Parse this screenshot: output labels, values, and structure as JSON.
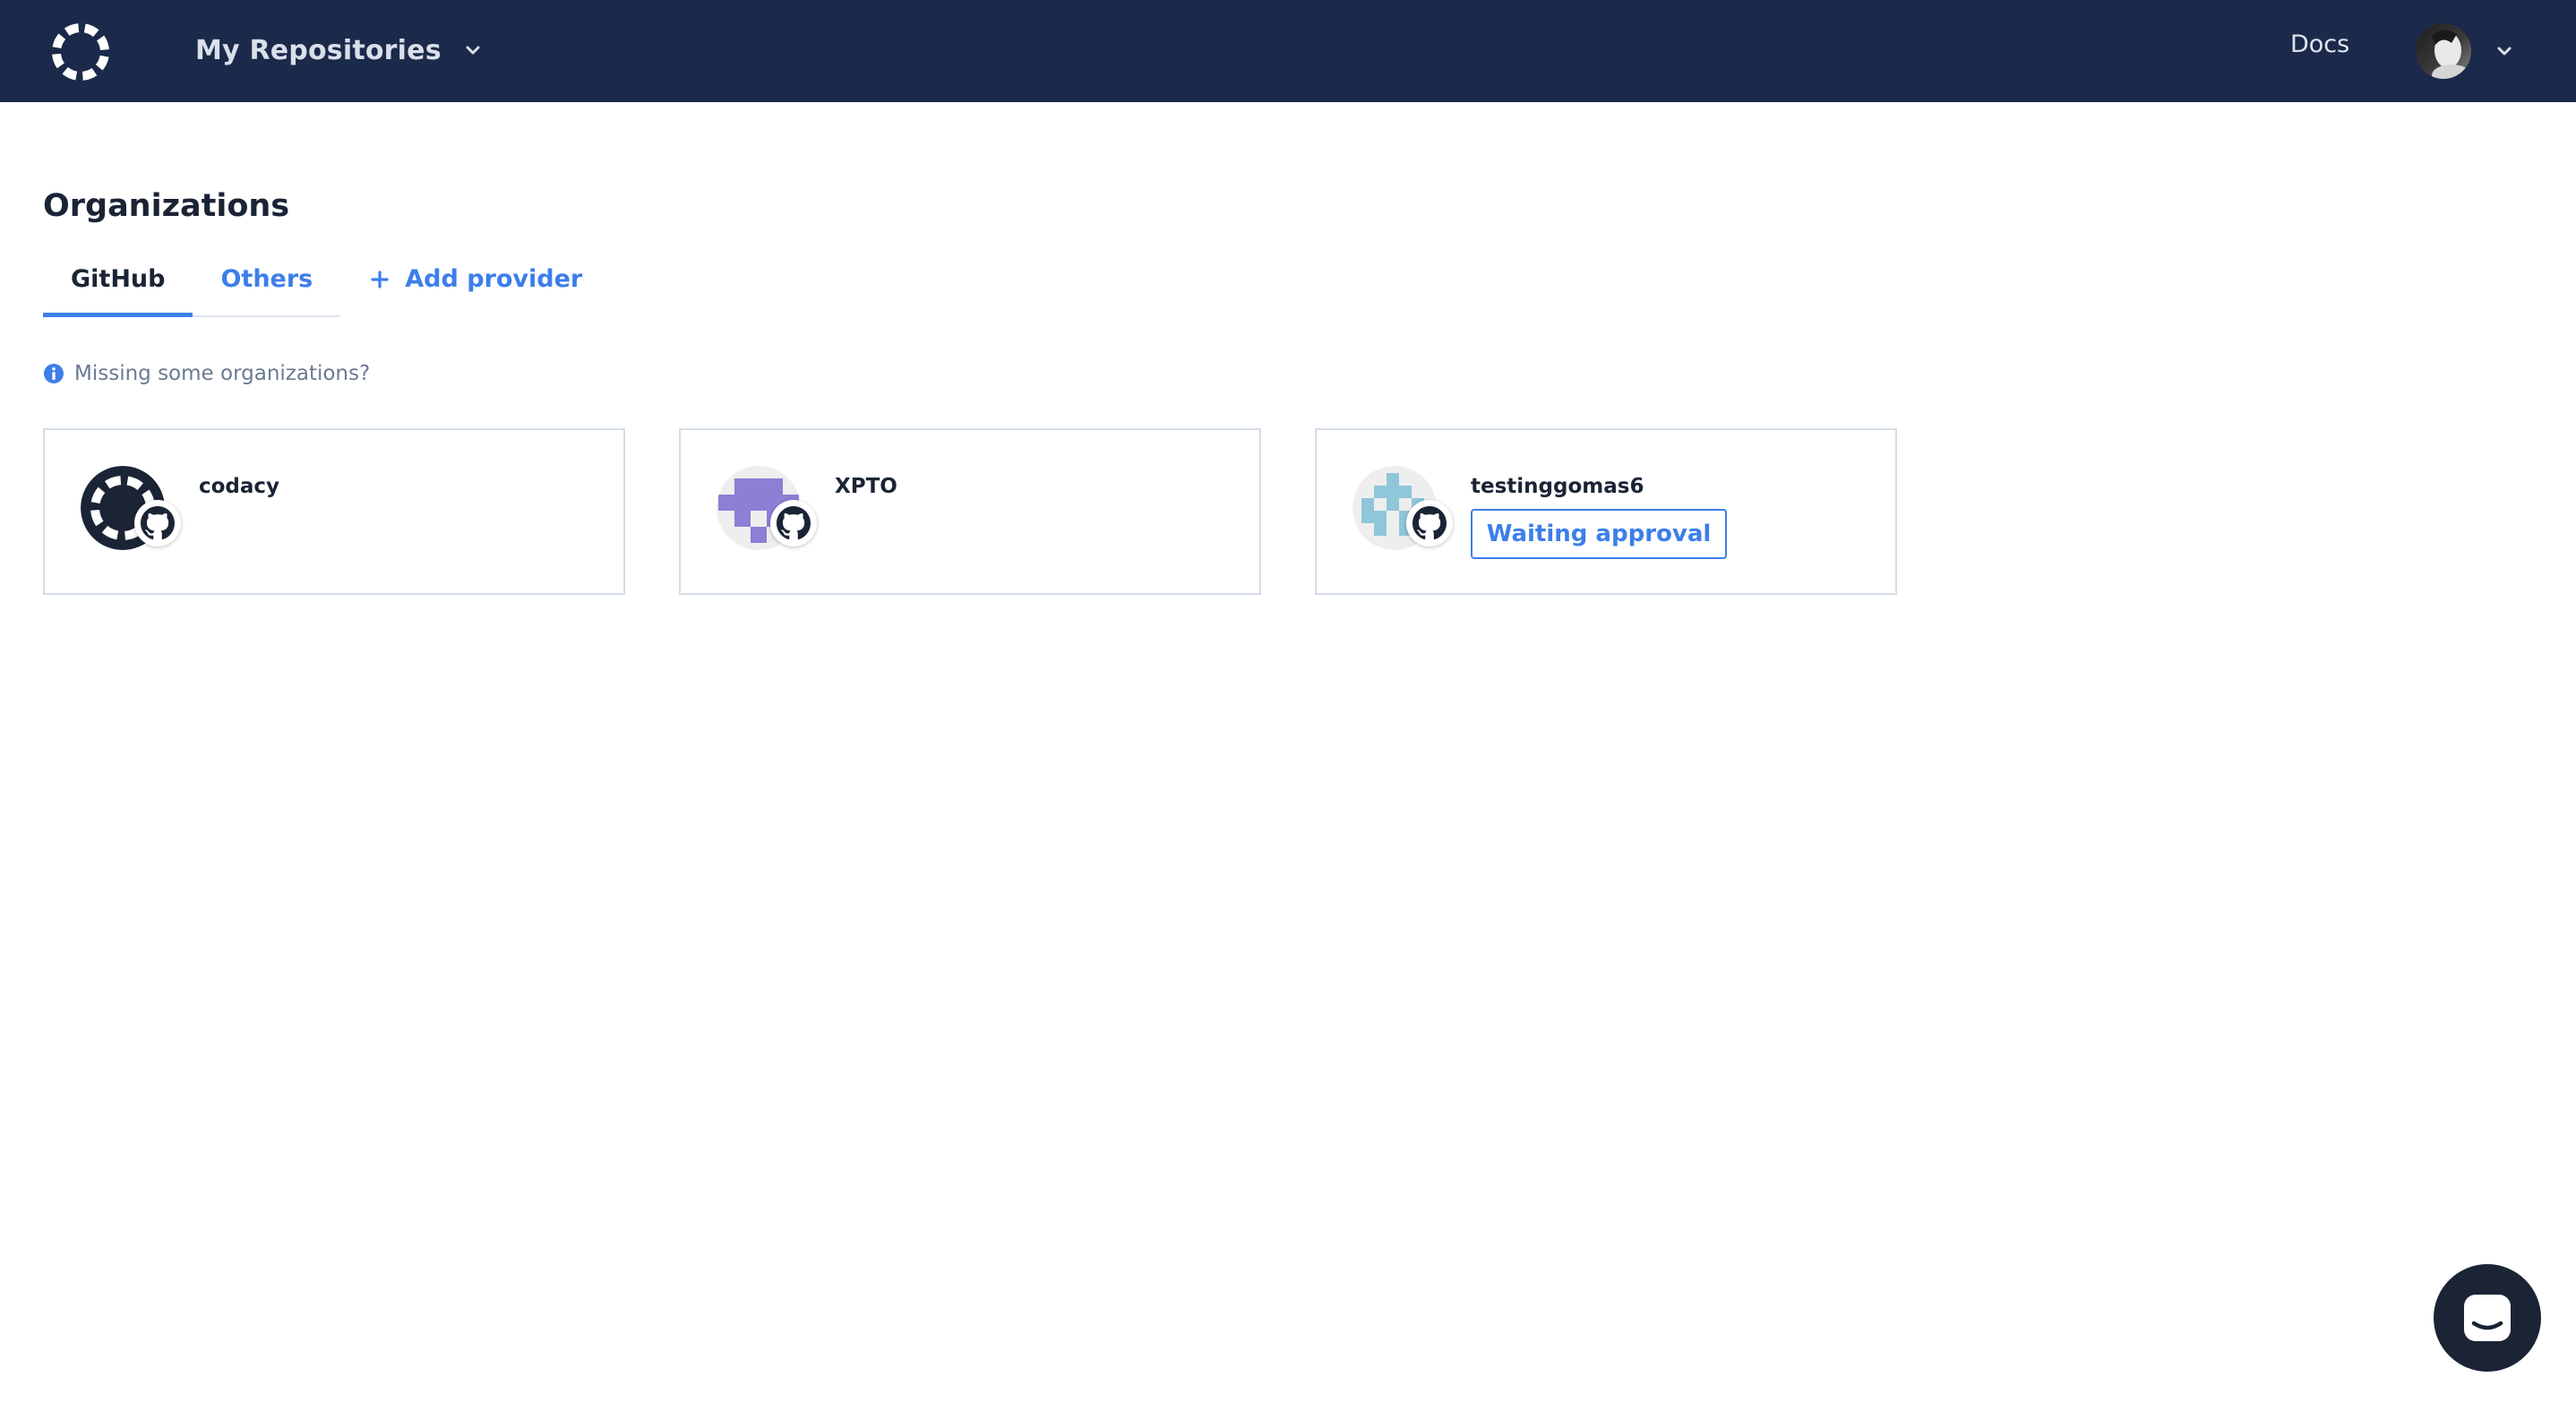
{
  "header": {
    "repo_switch_label": "My Repositories",
    "docs_label": "Docs"
  },
  "page": {
    "title": "Organizations"
  },
  "tabs": [
    {
      "label": "GitHub",
      "active": true
    },
    {
      "label": "Others",
      "active": false
    }
  ],
  "add_provider_label": "Add provider",
  "hint_text": "Missing some organizations?",
  "organizations": [
    {
      "name": "codacy",
      "status": ""
    },
    {
      "name": "XPTO",
      "status": ""
    },
    {
      "name": "testinggomas6",
      "status": "Waiting approval"
    }
  ],
  "colors": {
    "header_bg": "#1b2a4a",
    "accent": "#3d7eea",
    "card_border": "#d3dce8",
    "text_primary": "#1a2435",
    "text_muted": "#6b7a93",
    "xpto_avatar": "#8b7fd6",
    "testing_avatar": "#8fc6d9"
  },
  "icons": {
    "logo": "codacy-logo-icon",
    "chevron": "chevron-down-icon",
    "plus": "plus-icon",
    "info": "info-icon",
    "provider_badge": "github-icon",
    "chat": "chat-icon"
  }
}
